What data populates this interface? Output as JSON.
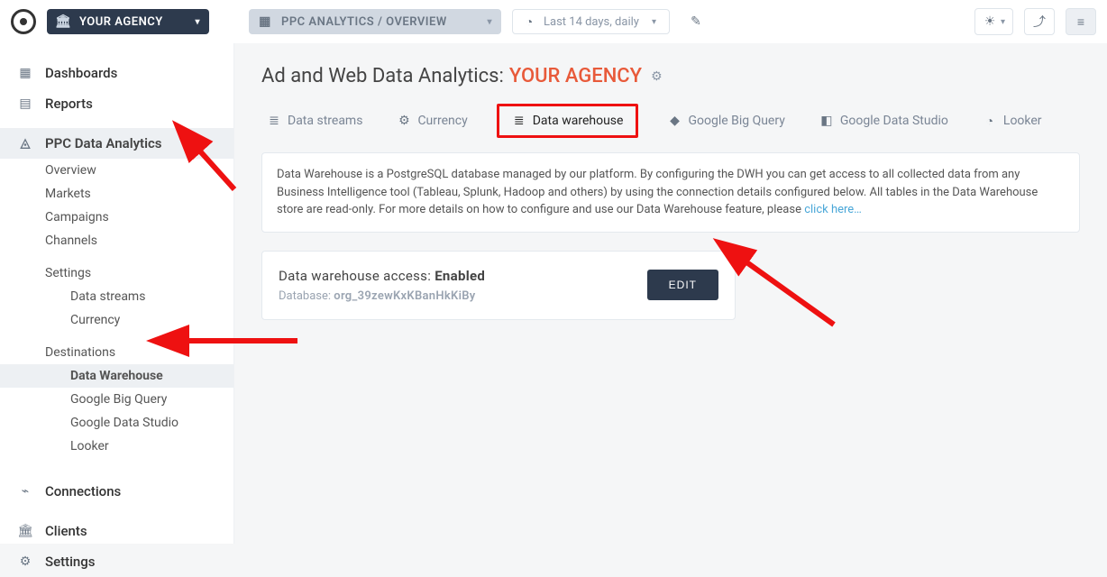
{
  "topbar": {
    "agency_pill": "YOUR AGENCY",
    "breadcrumb": "PPC ANALYTICS / OVERVIEW",
    "date_range": "Last 14 days, daily"
  },
  "sidebar": {
    "dashboards": "Dashboards",
    "reports": "Reports",
    "ppc": "PPC Data Analytics",
    "overview": "Overview",
    "markets": "Markets",
    "campaigns": "Campaigns",
    "channels": "Channels",
    "settings": "Settings",
    "data_streams": "Data streams",
    "currency": "Currency",
    "destinations": "Destinations",
    "data_warehouse": "Data Warehouse",
    "google_big_query": "Google Big Query",
    "google_data_studio": "Google Data Studio",
    "looker": "Looker",
    "connections": "Connections",
    "clients": "Clients",
    "settings_bottom": "Settings"
  },
  "page": {
    "title_prefix": "Ad and Web Data Analytics:",
    "agency_name": "YOUR AGENCY"
  },
  "tabs": {
    "data_streams": "Data streams",
    "currency": "Currency",
    "data_warehouse": "Data warehouse",
    "google_big_query": "Google Big Query",
    "google_data_studio": "Google Data Studio",
    "looker": "Looker"
  },
  "info": {
    "text": "Data Warehouse is a PostgreSQL database managed by our platform. By configuring the DWH you can get access to all collected data from any Business Intelligence tool (Tableau, Splunk, Hadoop and others) by using the connection details configured below. All tables in the Data Warehouse store are read-only. For more details on how to configure and use our Data Warehouse feature, please ",
    "link": "click here…"
  },
  "access": {
    "label": "Data warehouse access: ",
    "status": "Enabled",
    "db_label": "Database: ",
    "db_name": "org_39zewKxKBanHkKiBy",
    "edit": "EDIT"
  }
}
